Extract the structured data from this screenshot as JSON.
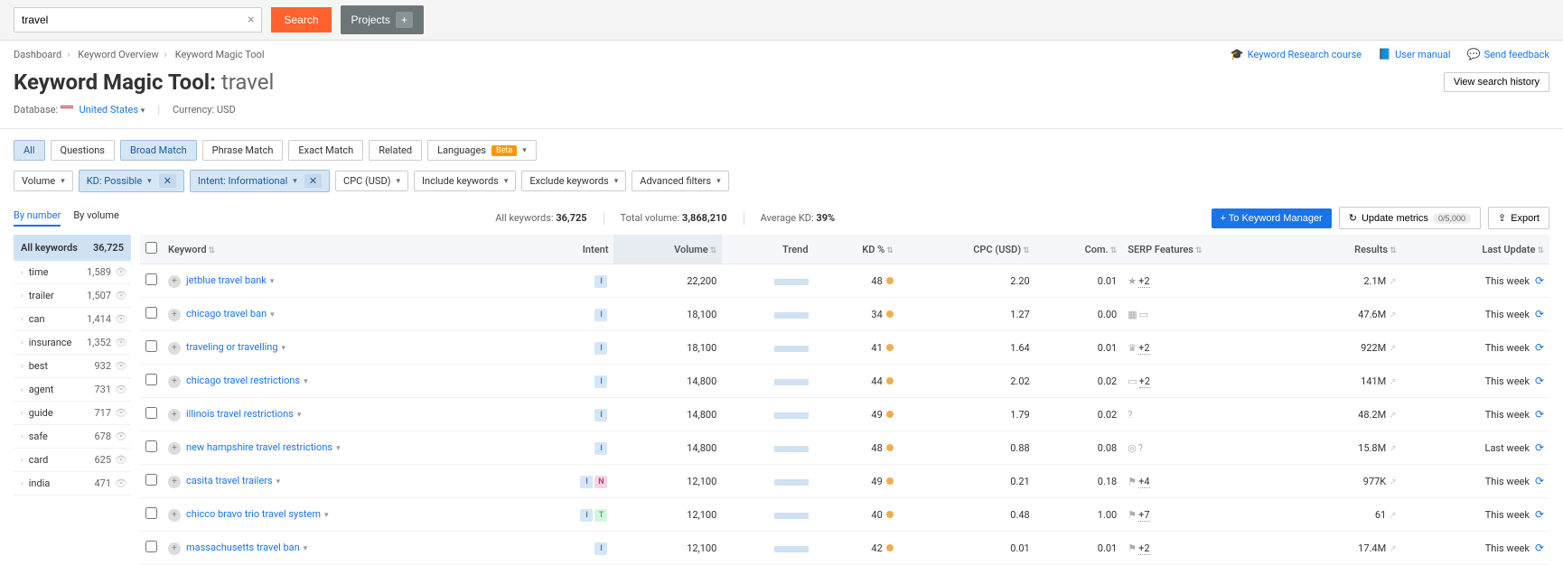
{
  "topbar": {
    "search_value": "travel",
    "search_btn": "Search",
    "projects_btn": "Projects"
  },
  "breadcrumb": [
    "Dashboard",
    "Keyword Overview",
    "Keyword Magic Tool"
  ],
  "header_links": {
    "research": "Keyword Research course",
    "manual": "User manual",
    "feedback": "Send feedback"
  },
  "title": {
    "prefix": "Keyword Magic Tool:",
    "keyword": "travel",
    "view_history": "View search history"
  },
  "db": {
    "label": "Database:",
    "country": "United States",
    "currency_label": "Currency:",
    "currency": "USD"
  },
  "match_tabs": [
    "All",
    "Questions",
    "Broad Match",
    "Phrase Match",
    "Exact Match",
    "Related"
  ],
  "match_active": [
    0,
    2
  ],
  "languages_label": "Languages",
  "beta": "Beta",
  "filters": {
    "volume": "Volume",
    "kd": "KD: Possible",
    "intent": "Intent: Informational",
    "cpc": "CPC (USD)",
    "include": "Include keywords",
    "exclude": "Exclude keywords",
    "advanced": "Advanced filters"
  },
  "sidebar_tabs": {
    "by_number": "By number",
    "by_volume": "By volume"
  },
  "stats": {
    "all_kw_label": "All keywords:",
    "all_kw": "36,725",
    "total_vol_label": "Total volume:",
    "total_vol": "3,868,210",
    "avg_kd_label": "Average KD:",
    "avg_kd": "39%"
  },
  "actions": {
    "to_manager": "To Keyword Manager",
    "update": "Update metrics",
    "update_count": "0/5,000",
    "export": "Export"
  },
  "sidebar": {
    "header": {
      "label": "All keywords",
      "count": "36,725"
    },
    "items": [
      {
        "label": "time",
        "count": "1,589"
      },
      {
        "label": "trailer",
        "count": "1,507"
      },
      {
        "label": "can",
        "count": "1,414"
      },
      {
        "label": "insurance",
        "count": "1,352"
      },
      {
        "label": "best",
        "count": "932"
      },
      {
        "label": "agent",
        "count": "731"
      },
      {
        "label": "guide",
        "count": "717"
      },
      {
        "label": "safe",
        "count": "678"
      },
      {
        "label": "card",
        "count": "625"
      },
      {
        "label": "india",
        "count": "471"
      }
    ]
  },
  "columns": [
    "",
    "Keyword",
    "Intent",
    "Volume",
    "Trend",
    "KD %",
    "CPC (USD)",
    "Com.",
    "SERP Features",
    "Results",
    "Last Update"
  ],
  "rows": [
    {
      "kw": "jetblue travel bank",
      "intent": [
        "I"
      ],
      "vol": "22,200",
      "kd": "48",
      "cpc": "2.20",
      "com": "0.01",
      "serp_icons": [
        "★"
      ],
      "serp_plus": "+2",
      "res": "2.1M",
      "last": "This week"
    },
    {
      "kw": "chicago travel ban",
      "intent": [
        "I"
      ],
      "vol": "18,100",
      "kd": "34",
      "cpc": "1.27",
      "com": "0.00",
      "serp_icons": [
        "▦",
        "▭"
      ],
      "serp_plus": "",
      "res": "47.6M",
      "last": "This week"
    },
    {
      "kw": "traveling or travelling",
      "intent": [
        "I"
      ],
      "vol": "18,100",
      "kd": "41",
      "cpc": "1.64",
      "com": "0.01",
      "serp_icons": [
        "♛"
      ],
      "serp_plus": "+2",
      "res": "922M",
      "last": "This week"
    },
    {
      "kw": "chicago travel restrictions",
      "intent": [
        "I"
      ],
      "vol": "14,800",
      "kd": "44",
      "cpc": "2.02",
      "com": "0.02",
      "serp_icons": [
        "▭"
      ],
      "serp_plus": "+2",
      "res": "141M",
      "last": "This week"
    },
    {
      "kw": "illinois travel restrictions",
      "intent": [
        "I"
      ],
      "vol": "14,800",
      "kd": "49",
      "cpc": "1.79",
      "com": "0.02",
      "serp_icons": [
        "?"
      ],
      "serp_plus": "",
      "res": "48.2M",
      "last": "This week"
    },
    {
      "kw": "new hampshire travel restrictions",
      "intent": [
        "I"
      ],
      "vol": "14,800",
      "kd": "48",
      "cpc": "0.88",
      "com": "0.08",
      "serp_icons": [
        "◎",
        "?"
      ],
      "serp_plus": "",
      "res": "15.8M",
      "last": "Last week"
    },
    {
      "kw": "casita travel trailers",
      "intent": [
        "I",
        "N"
      ],
      "vol": "12,100",
      "kd": "49",
      "cpc": "0.21",
      "com": "0.18",
      "serp_icons": [
        "⚑"
      ],
      "serp_plus": "+4",
      "res": "977K",
      "last": "This week"
    },
    {
      "kw": "chicco bravo trio travel system",
      "intent": [
        "I",
        "T"
      ],
      "vol": "12,100",
      "kd": "40",
      "cpc": "0.48",
      "com": "1.00",
      "serp_icons": [
        "⚑"
      ],
      "serp_plus": "+7",
      "res": "61",
      "last": "This week"
    },
    {
      "kw": "massachusetts travel ban",
      "intent": [
        "I"
      ],
      "vol": "12,100",
      "kd": "42",
      "cpc": "0.01",
      "com": "0.01",
      "serp_icons": [
        "⚑"
      ],
      "serp_plus": "+2",
      "res": "17.4M",
      "last": "This week"
    }
  ]
}
